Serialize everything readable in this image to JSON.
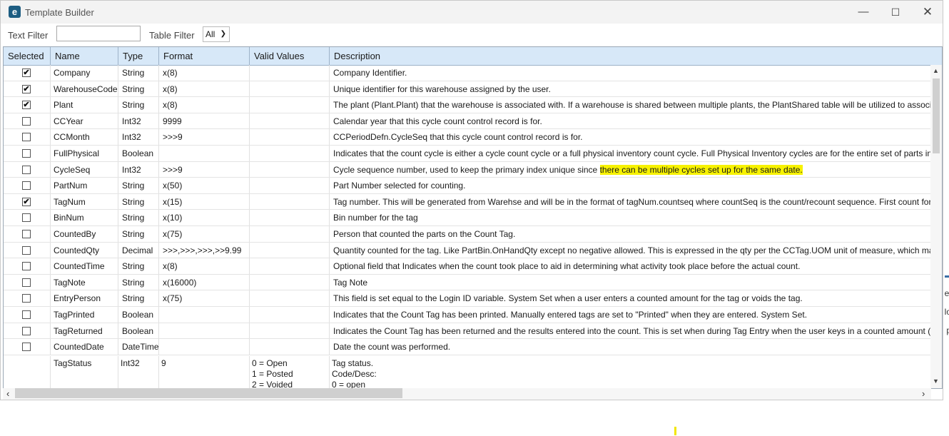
{
  "window": {
    "title": "Template Builder",
    "icon": "epicor-logo-icon",
    "accent": "#1d5d82"
  },
  "filters": {
    "text_filter_label": "Text Filter",
    "text_filter_value": "",
    "table_filter_label": "Table Filter",
    "table_filter_value": "All"
  },
  "columns": [
    "Selected",
    "Name",
    "Type",
    "Format",
    "Valid Values",
    "Description"
  ],
  "rows": [
    {
      "selected": true,
      "name": "Company",
      "type": "String",
      "format": "x(8)",
      "valid": "",
      "desc": "Company Identifier."
    },
    {
      "selected": true,
      "name": "WarehouseCode",
      "type": "String",
      "format": "x(8)",
      "valid": "",
      "desc": "Unique identifier for this warehouse assigned by the user."
    },
    {
      "selected": true,
      "name": "Plant",
      "type": "String",
      "format": "x(8)",
      "valid": "",
      "desc": "The plant (Plant.Plant) that the warehouse is associated with. If a warehouse is shared between multiple plants, the PlantShared table will be utilized to associat"
    },
    {
      "selected": false,
      "name": "CCYear",
      "type": "Int32",
      "format": "9999",
      "valid": "",
      "desc": "Calendar year that this cycle count control record is for."
    },
    {
      "selected": false,
      "name": "CCMonth",
      "type": "Int32",
      "format": ">>>9",
      "valid": "",
      "desc": "CCPeriodDefn.CycleSeq that this cycle count control record is for."
    },
    {
      "selected": false,
      "name": "FullPhysical",
      "type": "Boolean",
      "format": "",
      "valid": "",
      "desc": "Indicates that the count cycle is either a cycle count cycle or a full physical inventory count cycle.  Full Physical Inventory cycles are for the entire set of parts in t"
    },
    {
      "selected": false,
      "name": "CycleSeq",
      "type": "Int32",
      "format": ">>>9",
      "valid": "",
      "desc": "Cycle sequence number, used to keep the primary index unique since ",
      "desc_hl": "there can be multiple cycles set up for the same date."
    },
    {
      "selected": false,
      "name": "PartNum",
      "type": "String",
      "format": "x(50)",
      "valid": "",
      "desc": "Part Number selected for counting."
    },
    {
      "selected": true,
      "name": "TagNum",
      "type": "String",
      "format": "x(15)",
      "valid": "",
      "desc": "Tag number. This will be generated from Warehse and will be in the format of tagNum.countseq where countSeq is the count/recount sequence. First count for"
    },
    {
      "selected": false,
      "name": "BinNum",
      "type": "String",
      "format": "x(10)",
      "valid": "",
      "desc": "Bin number for the tag"
    },
    {
      "selected": false,
      "name": "CountedBy",
      "type": "String",
      "format": "x(75)",
      "valid": "",
      "desc": "Person that counted the parts on the Count Tag."
    },
    {
      "selected": false,
      "name": "CountedQty",
      "type": "Decimal",
      "format": ">>>,>>>,>>>,>>9.99",
      "valid": "",
      "desc": "Quantity counted for the tag. Like PartBin.OnHandQty except no negative allowed. This is expressed in the qty per the CCTag.UOM unit of measure, which may"
    },
    {
      "selected": false,
      "name": "CountedTime",
      "type": "String",
      "format": "x(8)",
      "valid": "",
      "desc": "Optional field that Indicates when the count took place to aid in determining what activity took place before the actual count."
    },
    {
      "selected": false,
      "name": "TagNote",
      "type": "String",
      "format": "x(16000)",
      "valid": "",
      "desc": "Tag Note"
    },
    {
      "selected": false,
      "name": "EntryPerson",
      "type": "String",
      "format": "x(75)",
      "valid": "",
      "desc": "This field is set equal to the Login ID variable.  System Set when a user enters a counted amount for the tag or voids the tag."
    },
    {
      "selected": false,
      "name": "TagPrinted",
      "type": "Boolean",
      "format": "",
      "valid": "",
      "desc": "Indicates that the Count Tag has been printed.  Manually entered tags are set to \"Printed\" when they are entered.  System Set."
    },
    {
      "selected": false,
      "name": "TagReturned",
      "type": "Boolean",
      "format": "",
      "valid": "",
      "desc": "Indicates the Count Tag has been returned and the results entered into the count.  This is set when during Tag Entry when the user keys in a counted amount (c"
    },
    {
      "selected": false,
      "name": "CountedDate",
      "type": "DateTime",
      "format": "",
      "valid": "",
      "desc": "Date the count was performed."
    }
  ],
  "last_row": {
    "name": "TagStatus",
    "type": "Int32",
    "format": "9",
    "valid_lines": [
      "0 = Open",
      "1 = Posted",
      "2 = Voided"
    ],
    "desc_lines": [
      "Tag status.",
      "Code/Desc:",
      "0 = open"
    ]
  },
  "highlight_color": "#f7f200",
  "header_color": "#d7e8f8"
}
